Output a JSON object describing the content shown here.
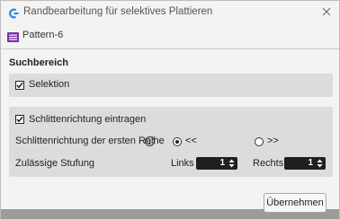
{
  "window": {
    "title": "Randbearbeitung für selektives Plattieren"
  },
  "pattern": {
    "label": "Pattern-6"
  },
  "search_section": {
    "title": "Suchbereich",
    "selection_label": "Selektion",
    "selection_checked": true
  },
  "carriage": {
    "enter_label": "Schlittenrichtung eintragen",
    "enter_checked": true,
    "first_row_label": "Schlittenrichtung der ersten Reihe",
    "option_left": "<<",
    "option_right": ">>",
    "selected_option": "<<",
    "step_label": "Zulässige Stufung",
    "left_label": "Links",
    "left_value": "1",
    "right_label": "Rechts",
    "right_value": "1"
  },
  "footer": {
    "ok_label": "Übernehmen"
  },
  "colors": {
    "panel_bg": "#dcdcdc",
    "spinner_bg": "#1f1f1f",
    "pattern_icon": "#7b2fa8",
    "app_icon": "#1e88e5"
  }
}
